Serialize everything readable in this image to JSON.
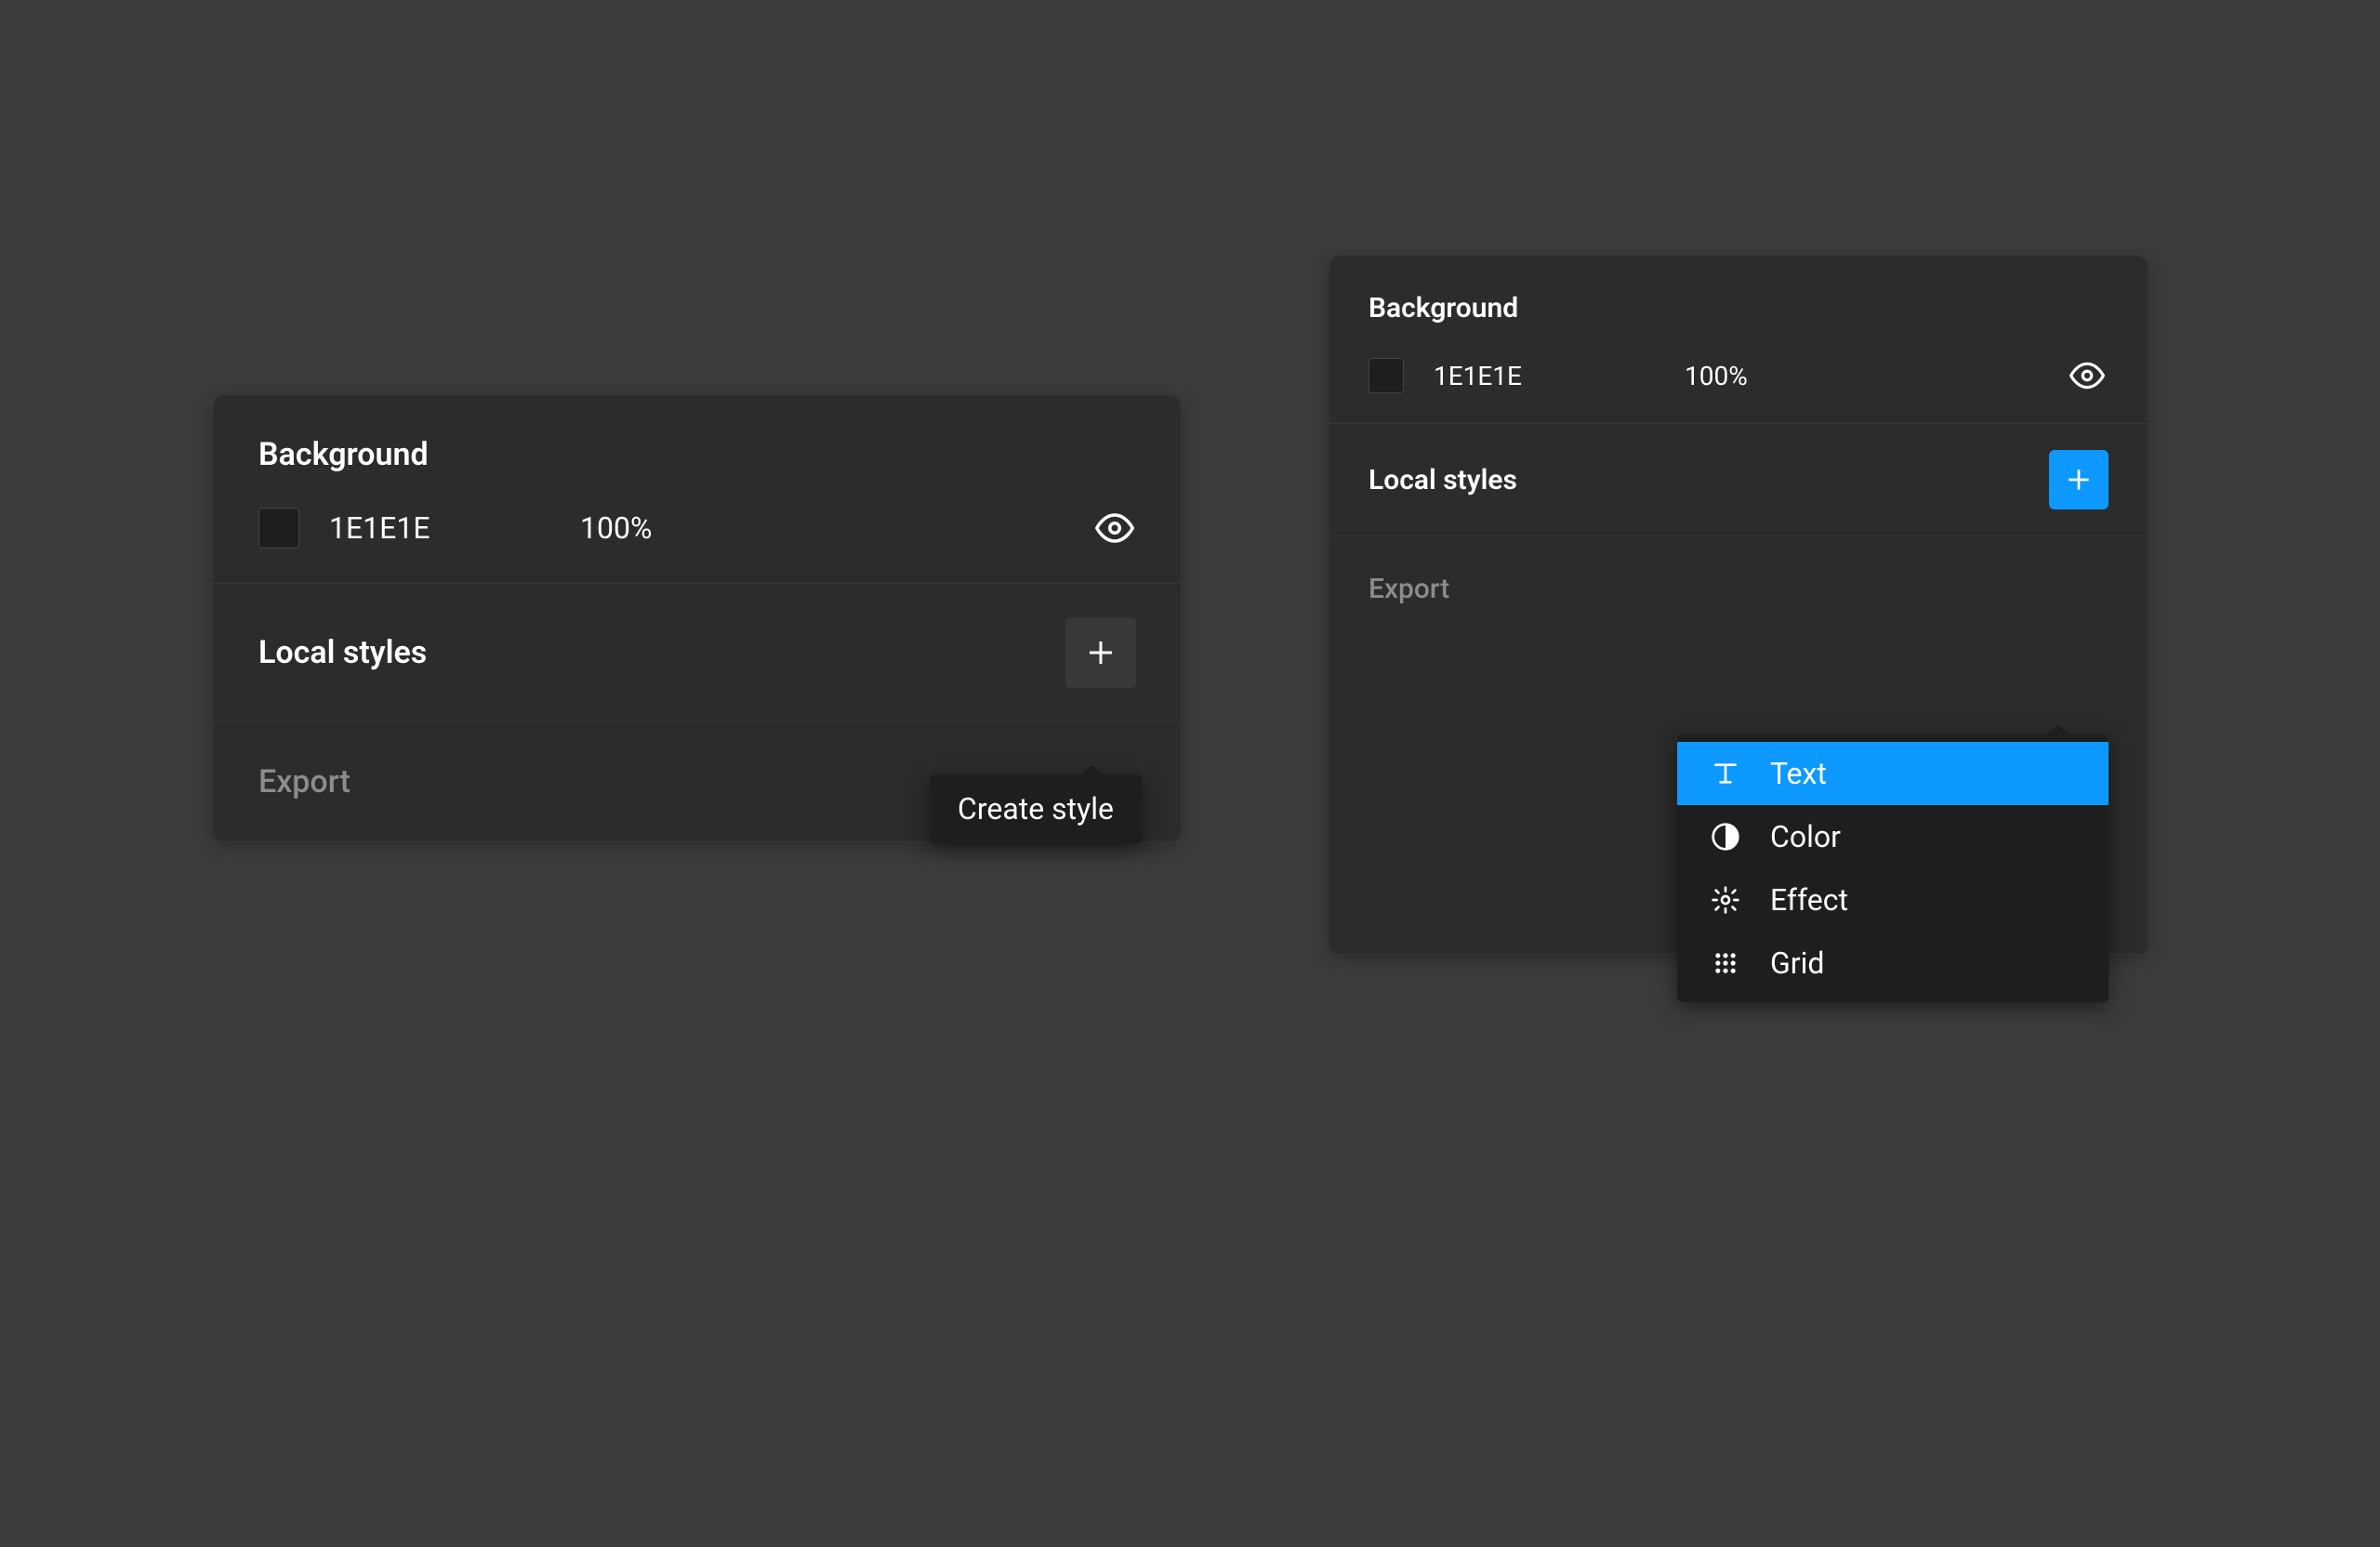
{
  "colors": {
    "accent": "#0d99ff",
    "panel_bg": "#2c2c2c",
    "swatch_value": "#1e1e1e"
  },
  "left_panel": {
    "background": {
      "title": "Background",
      "hex": "1E1E1E",
      "opacity": "100%"
    },
    "local_styles": {
      "title": "Local styles"
    },
    "export": {
      "title": "Export"
    },
    "tooltip": "Create style"
  },
  "right_panel": {
    "background": {
      "title": "Background",
      "hex": "1E1E1E",
      "opacity": "100%"
    },
    "local_styles": {
      "title": "Local styles"
    },
    "export": {
      "title": "Export"
    },
    "dropdown": {
      "items": [
        {
          "label": "Text",
          "icon": "text",
          "selected": true
        },
        {
          "label": "Color",
          "icon": "color",
          "selected": false
        },
        {
          "label": "Effect",
          "icon": "effect",
          "selected": false
        },
        {
          "label": "Grid",
          "icon": "grid",
          "selected": false
        }
      ]
    }
  }
}
